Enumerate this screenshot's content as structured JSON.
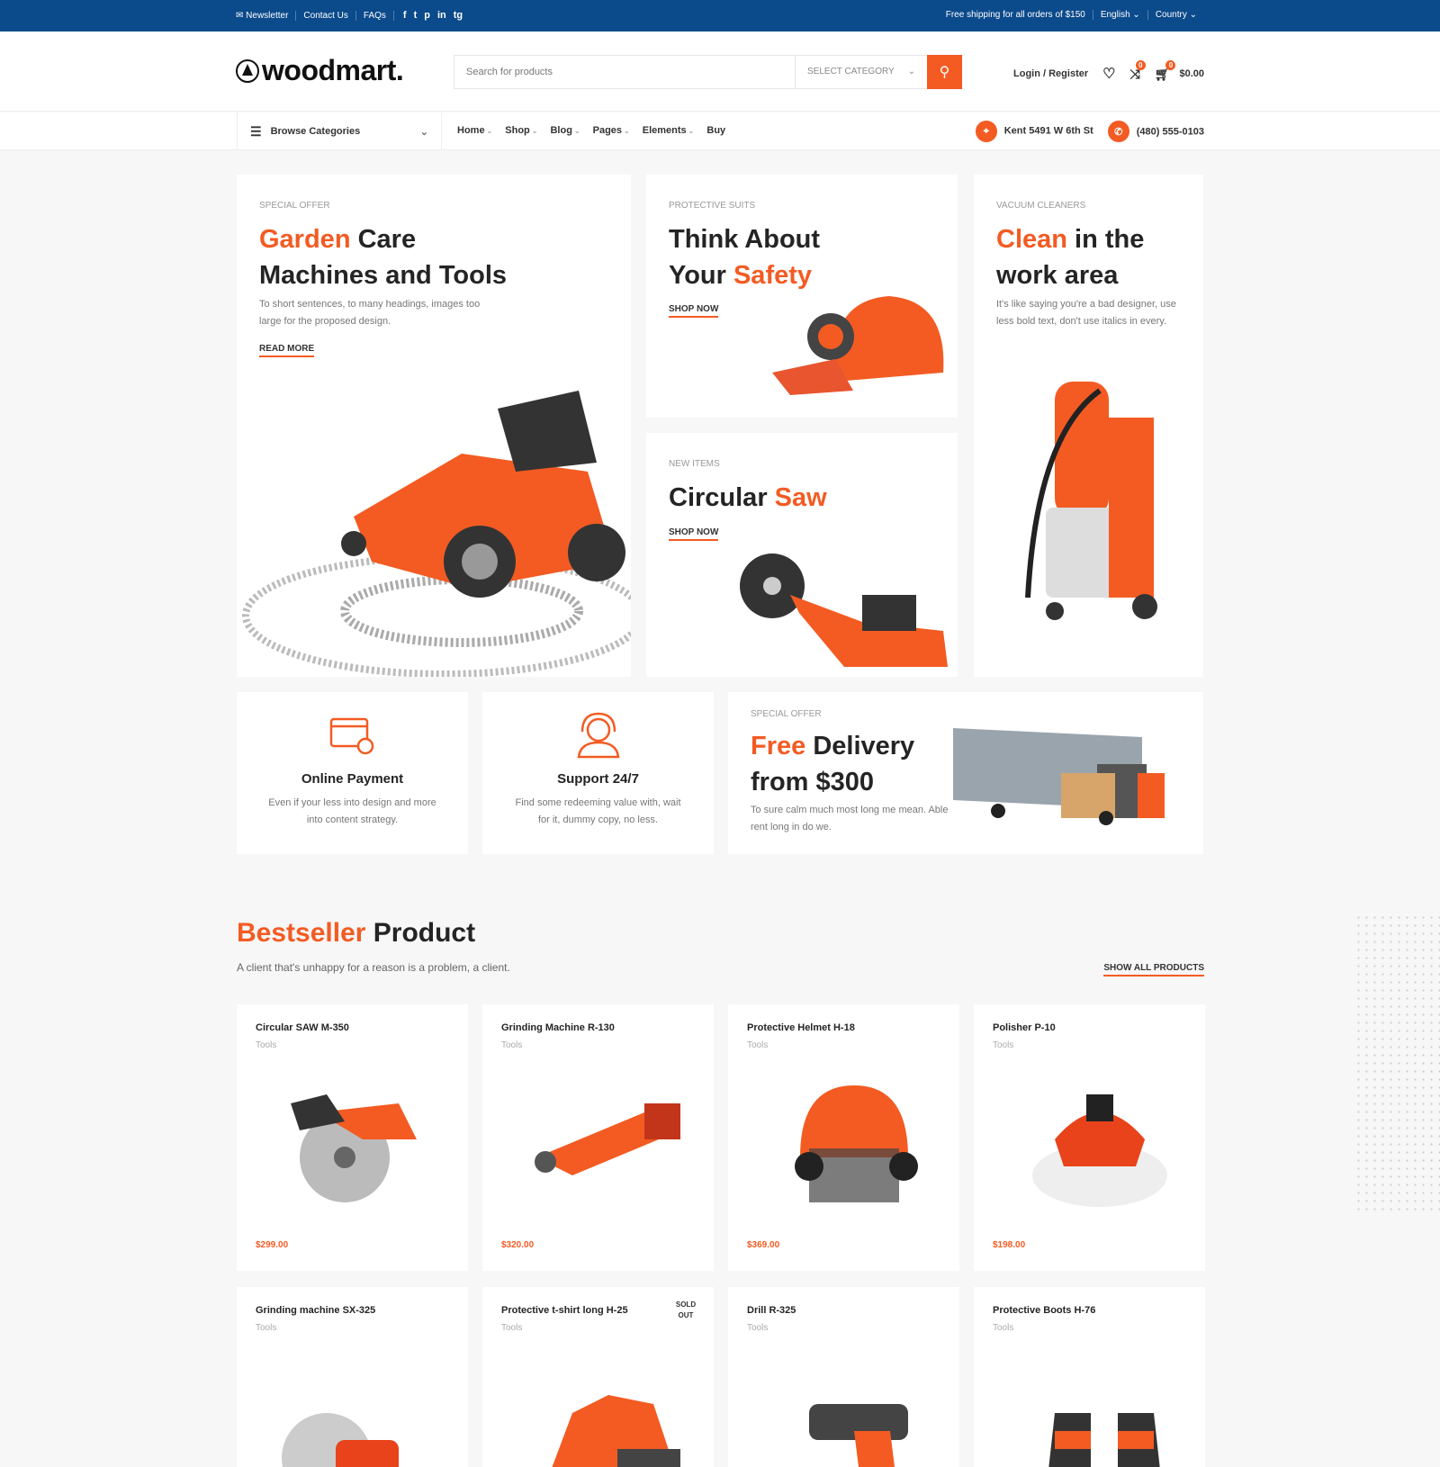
{
  "topbar": {
    "newsletter": "Newsletter",
    "contact": "Contact Us",
    "faqs": "FAQs",
    "social": [
      "f",
      "t",
      "p",
      "in",
      "tg"
    ],
    "shipping": "Free shipping for all orders of $150",
    "language": "English",
    "country": "Country"
  },
  "header": {
    "logo": "woodmart.",
    "search_placeholder": "Search for products",
    "category": "SELECT CATEGORY",
    "login": "Login / Register",
    "compare_count": "0",
    "cart_count": "0",
    "cart_total": "$0.00"
  },
  "nav": {
    "browse": "Browse Categories",
    "items": [
      "Home",
      "Shop",
      "Blog",
      "Pages",
      "Elements",
      "Buy"
    ],
    "address": "Kent 5491 W 6th St",
    "phone": "(480) 555-0103"
  },
  "banners": {
    "garden": {
      "kicker": "SPECIAL OFFER",
      "accent": "Garden",
      "title1": " Care",
      "title2": "Machines and Tools",
      "text1": "To short sentences, to many headings, images too",
      "text2": "large for the proposed design.",
      "link": "READ MORE"
    },
    "safety": {
      "kicker": "PROTECTIVE SUITS",
      "title1": "Think About",
      "title2a": "Your ",
      "accent": "Safety",
      "link": "SHOP NOW"
    },
    "saw": {
      "kicker": "NEW ITEMS",
      "title": "Circular ",
      "accent": "Saw",
      "link": "SHOP NOW"
    },
    "vacuum": {
      "kicker": "VACUUM CLEANERS",
      "accent": "Clean",
      "title1": " in the",
      "title2": "work area",
      "text1": "It's like saying you're a bad designer, use",
      "text2": "less bold text, don't use italics in every."
    },
    "delivery": {
      "kicker": "SPECIAL OFFER",
      "accent": "Free",
      "title1": " Delivery",
      "title2": "from $300",
      "text1": "To sure calm much most long me mean. Able",
      "text2": "rent long in do we."
    }
  },
  "features": [
    {
      "title": "Online Payment",
      "text1": "Even if your less into design and more",
      "text2": "into content strategy."
    },
    {
      "title": "Support 24/7",
      "text1": "Find some redeeming value with, wait",
      "text2": "for it, dummy copy, no less."
    }
  ],
  "bestseller": {
    "accent": "Bestseller",
    "title": " Product",
    "subtitle": "A client that's unhappy for a reason is a problem, a client.",
    "show_all": "SHOW ALL PRODUCTS"
  },
  "products": [
    {
      "name": "Circular SAW M-350",
      "cat": "Tools",
      "price": "$299.00"
    },
    {
      "name": "Grinding Machine R-130",
      "cat": "Tools",
      "price": "$320.00"
    },
    {
      "name": "Protective Helmet H-18",
      "cat": "Tools",
      "price": "$369.00"
    },
    {
      "name": "Polisher P-10",
      "cat": "Tools",
      "price": "$198.00"
    },
    {
      "name": "Grinding machine SX-325",
      "cat": "Tools"
    },
    {
      "name": "Protective t-shirt long H-25",
      "cat": "Tools",
      "badge": "SOLD OUT"
    },
    {
      "name": "Drill R-325",
      "cat": "Tools"
    },
    {
      "name": "Protective Boots H-76",
      "cat": "Tools"
    }
  ],
  "colors": {
    "accent": "#f35b23",
    "topbar": "#0b4a8b"
  }
}
